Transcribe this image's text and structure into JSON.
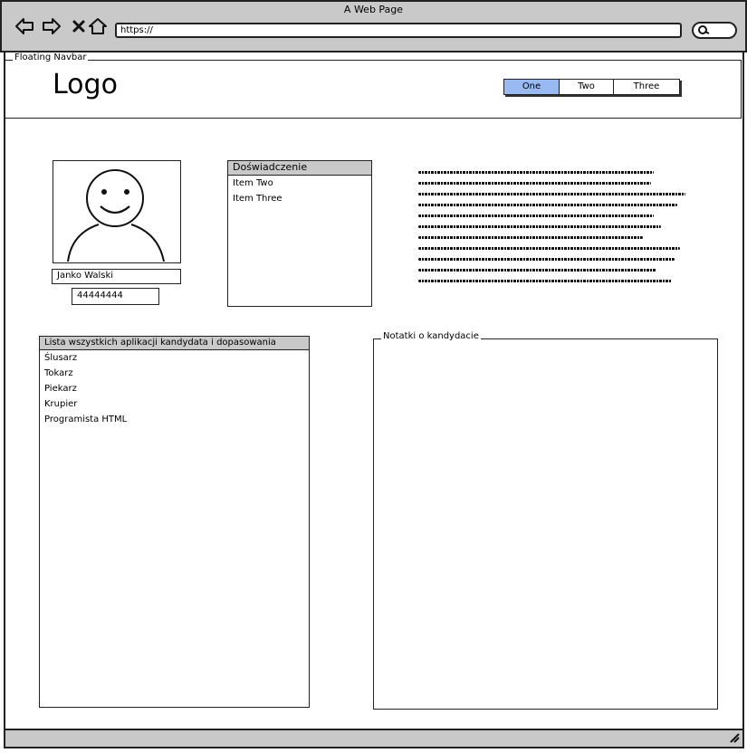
{
  "window": {
    "title": "A Web Page",
    "url": "https://",
    "nav_icons": [
      "back-arrow-icon",
      "forward-arrow-icon",
      "close-x-icon",
      "home-icon"
    ],
    "search_icon": "search-icon"
  },
  "navbar": {
    "legend": "Floating Navbar",
    "logo": "Logo",
    "tabs": [
      {
        "label": "One",
        "active": true
      },
      {
        "label": "Two",
        "active": false
      },
      {
        "label": "Three",
        "active": false
      }
    ],
    "active_color": "#98b9f2"
  },
  "profile": {
    "avatar_icon": "user-avatar-icon",
    "name": "Janko Walski",
    "phone": "44444444"
  },
  "experience_list": {
    "header": "Doświadczenie",
    "items": [
      "Item Two",
      "Item Three"
    ]
  },
  "applications": {
    "header": "Lista wszystkich aplikacji kandydata i dopasowania",
    "items": [
      "Ślusarz",
      "Tokarz",
      "Piekarz",
      "Krupier",
      "Programista HTML"
    ]
  },
  "notes": {
    "legend": "Notatki o kandydacie"
  },
  "theme": {
    "chrome_gray": "#c9c9c9",
    "border": "#222222"
  }
}
